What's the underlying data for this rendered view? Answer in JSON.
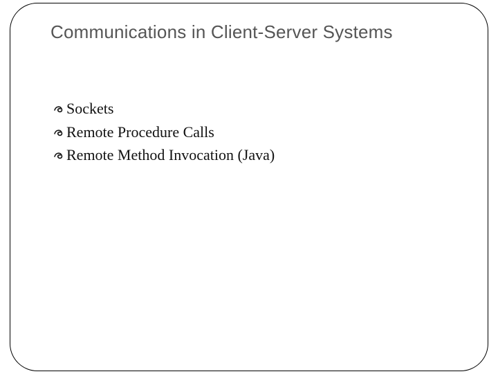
{
  "slide": {
    "title": "Communications in Client-Server Systems",
    "bullets": [
      {
        "text": "Sockets"
      },
      {
        "text": "Remote Procedure Calls"
      },
      {
        "text": "Remote Method Invocation (Java)"
      }
    ]
  }
}
